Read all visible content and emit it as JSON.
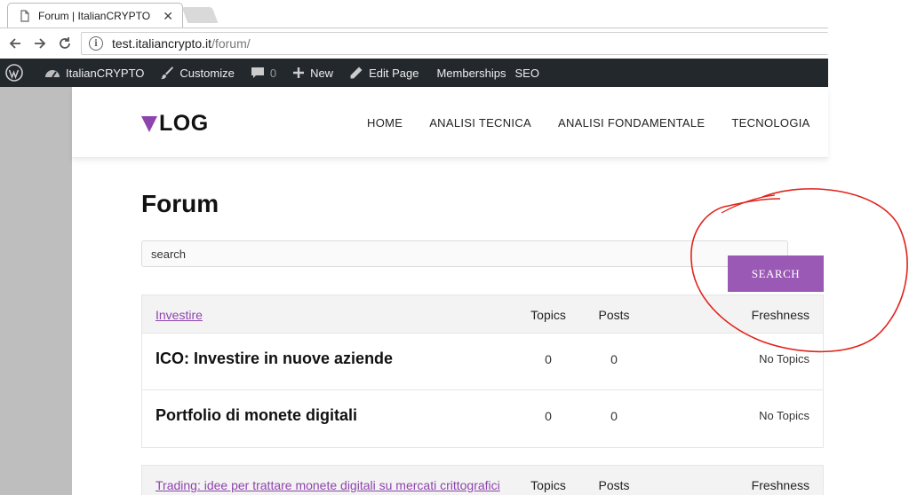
{
  "browser": {
    "tab_title": "Forum | ItalianCRYPTO",
    "url_host": "test.italiancrypto.it",
    "url_path": "/forum/"
  },
  "adminbar": {
    "site_name": "ItalianCRYPTO",
    "customize": "Customize",
    "comments_count": "0",
    "new": "New",
    "edit_page": "Edit Page",
    "memberships": "Memberships",
    "seo": "SEO"
  },
  "site": {
    "logo_text": "LOG",
    "accent_color": "#9b59b6",
    "menu": [
      "HOME",
      "ANALISI TECNICA",
      "ANALISI FONDAMENTALE",
      "TECNOLOGIA"
    ]
  },
  "page": {
    "title": "Forum",
    "search_value": "search",
    "search_button": "SEARCH"
  },
  "forums": [
    {
      "category": "Investire",
      "col_topics": "Topics",
      "col_posts": "Posts",
      "col_freshness": "Freshness",
      "items": [
        {
          "name": "ICO: Investire in nuove aziende",
          "topics": "0",
          "posts": "0",
          "freshness": "No Topics"
        },
        {
          "name": "Portfolio di monete digitali",
          "topics": "0",
          "posts": "0",
          "freshness": "No Topics"
        }
      ]
    },
    {
      "category": "Trading: idee per trattare monete digitali su mercati crittografici",
      "col_topics": "Topics",
      "col_posts": "Posts",
      "col_freshness": "Freshness",
      "items": []
    }
  ]
}
